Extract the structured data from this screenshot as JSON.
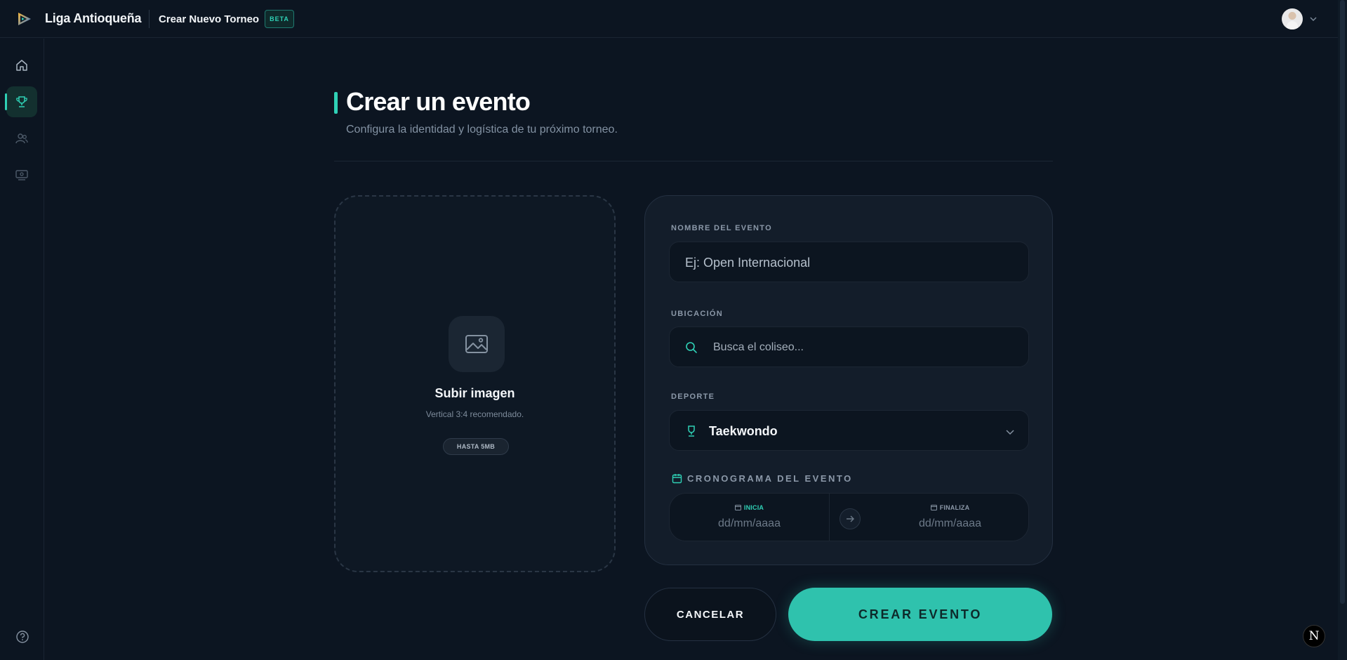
{
  "app": {
    "brand": "Liga Antioqueña",
    "page_name": "Crear Nuevo Torneo",
    "badge": "BETA",
    "accent_color": "#2fd1b6"
  },
  "sidebar": {
    "items": [
      {
        "icon": "home-icon",
        "active": false
      },
      {
        "icon": "trophy-icon",
        "active": true
      },
      {
        "icon": "users-icon",
        "active": false
      },
      {
        "icon": "payments-icon",
        "active": false
      }
    ],
    "help_icon": "help-circle-icon"
  },
  "header": {
    "title": "Crear un evento",
    "subtitle": "Configura la identidad y logística de tu próximo torneo."
  },
  "upload": {
    "title": "Subir imagen",
    "hint": "Vertical 3:4 recomendado.",
    "limit": "HASTA 5MB"
  },
  "form": {
    "name_label": "NOMBRE DEL EVENTO",
    "name_placeholder": "Ej: Open Internacional",
    "location_label": "UBICACIÓN",
    "location_placeholder": "Busca el coliseo...",
    "sport_label": "DEPORTE",
    "sport_value": "Taekwondo",
    "schedule_label": "CRONOGRAMA DEL EVENTO",
    "start_label": "INICIA",
    "start_placeholder": "dd/mm/aaaa",
    "end_label": "FINALIZA",
    "end_placeholder": "dd/mm/aaaa"
  },
  "actions": {
    "cancel": "CANCELAR",
    "create": "CREAR EVENTO"
  },
  "dev_badge": "N"
}
